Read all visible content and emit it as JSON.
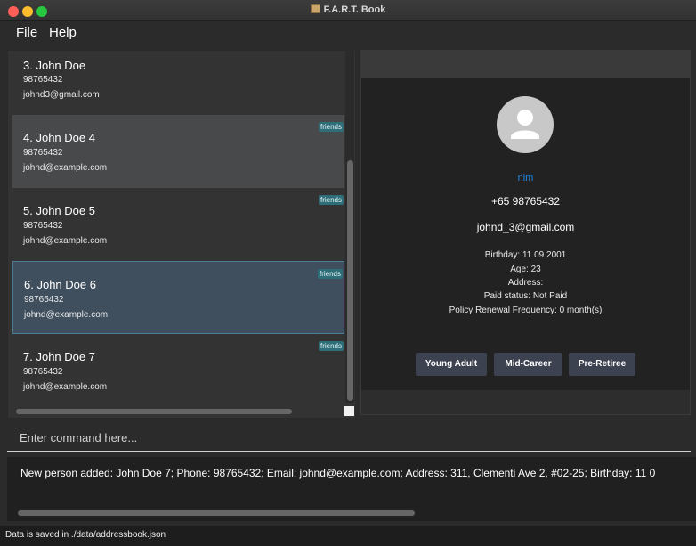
{
  "window": {
    "title": "F.A.R.T. Book"
  },
  "menu": {
    "file": "File",
    "help": "Help"
  },
  "persons": [
    {
      "index": "3.",
      "name": "John Doe",
      "phone": "98765432",
      "email": "johnd3@gmail.com",
      "tag": ""
    },
    {
      "index": "4.",
      "name": "John Doe 4",
      "phone": "98765432",
      "email": "johnd@example.com",
      "tag": "friends"
    },
    {
      "index": "5.",
      "name": "John Doe  5",
      "phone": "98765432",
      "email": "johnd@example.com",
      "tag": "friends"
    },
    {
      "index": "6.",
      "name": "John Doe 6",
      "phone": "98765432",
      "email": "johnd@example.com",
      "tag": "friends"
    },
    {
      "index": "7.",
      "name": "John Doe 7",
      "phone": "98765432",
      "email": "johnd@example.com",
      "tag": "friends"
    }
  ],
  "detail": {
    "nickname": "nim",
    "phone": "+65 98765432",
    "email": "johnd_3@gmail.com",
    "birthday": "Birthday: 11 09 2001",
    "age": "Age: 23",
    "address": "Address:",
    "paid_status": "Paid status: Not Paid",
    "policy_frequency": "Policy Renewal Frequency: 0 month(s)",
    "buttons": [
      "Young Adult",
      "Mid-Career",
      "Pre-Retiree"
    ]
  },
  "command": {
    "placeholder": "Enter command here...",
    "value": ""
  },
  "result": {
    "text": "New person added: John Doe 7; Phone: 98765432; Email: johnd@example.com; Address: 311, Clementi Ave 2, #02-25; Birthday: 11 0"
  },
  "status": {
    "text": "Data is saved in ./data/addressbook.json"
  },
  "colors": {
    "background": "#2b2b2b",
    "card_selected": "#3f4f5e",
    "card_hover": "#48494a",
    "tag": "#2e6e78",
    "nickname": "#1e88e5",
    "button": "#3d4250"
  }
}
